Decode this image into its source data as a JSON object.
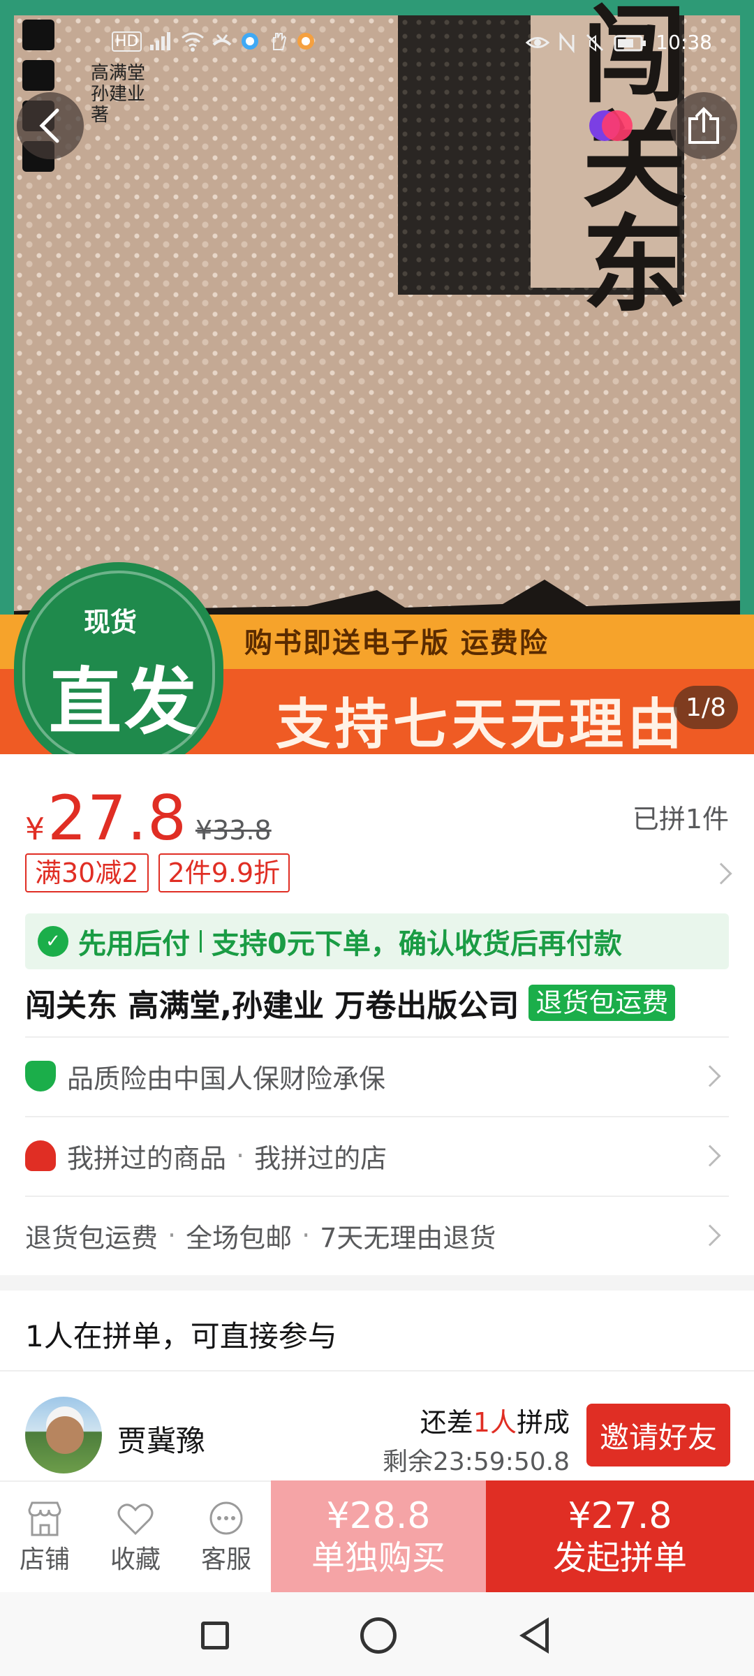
{
  "status_bar": {
    "left_icons": [
      "hd-icon",
      "5g-signal-icon",
      "wifi-icon",
      "missed-call-icon",
      "app-icon",
      "hand-icon",
      "app-icon"
    ],
    "right_icons": [
      "eye-icon",
      "nfc-icon",
      "mute-icon",
      "battery-icon"
    ],
    "hd": "HD",
    "time": "10:38"
  },
  "hero": {
    "image_counter": "1/8",
    "cover_title": "闯关东",
    "cover_credit": "高满堂 孙建业 著",
    "badge_top": "现货",
    "badge_main": "直发",
    "gift_text": "购书即送电子版 运费险",
    "slogan": "支持七天无理由",
    "colors": {
      "green": "#2e9a76",
      "orange": "#f6a32b",
      "red_orange": "#ef5b24",
      "cover": "#c4a994"
    }
  },
  "price": {
    "currency": "¥",
    "current": "27.8",
    "original": "¥33.8",
    "sold": "已拼1件",
    "accent": "#e02e24"
  },
  "promo_tags": [
    "满30减2",
    "2件9.9折"
  ],
  "pay_later": {
    "label": "先用后付",
    "text": "支持0元下单，确认收货后再付款"
  },
  "product": {
    "title": "闯关东 高满堂,孙建业 万卷出版公司",
    "tag": "退货包运费"
  },
  "info_rows": {
    "insurance": "品质险由中国人保财险承保",
    "purchased_goods": "我拼过的商品",
    "purchased_store": "我拼过的店",
    "service_1": "退货包运费",
    "service_2": "全场包邮",
    "service_3": "7天无理由退货",
    "separator": "·"
  },
  "group_buy": {
    "title": "1人在拼单，可直接参与",
    "user_name": "贾冀豫",
    "need_prefix": "还差",
    "need_count": "1人",
    "need_suffix": "拼成",
    "remaining": "剩余23:59:50.8",
    "invite_label": "邀请好友"
  },
  "bottom_bar": {
    "store": "店铺",
    "favorite": "收藏",
    "service": "客服",
    "solo_price": "¥28.8",
    "solo_label": "单独购买",
    "group_price": "¥27.8",
    "group_label": "发起拼单"
  }
}
